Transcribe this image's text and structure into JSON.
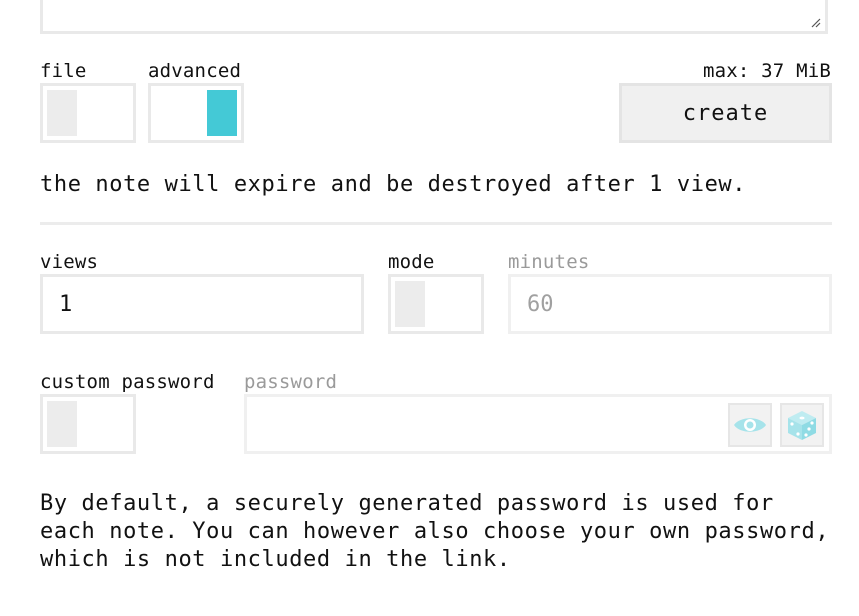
{
  "file_toggle": {
    "label": "file",
    "state": "off"
  },
  "advanced_toggle": {
    "label": "advanced",
    "state": "on"
  },
  "max_size_label": "max: 37 MiB",
  "create_button_label": "create",
  "expire_message": "the note will expire and be destroyed after 1 view.",
  "views": {
    "label": "views",
    "value": "1"
  },
  "mode_toggle": {
    "label": "mode",
    "state": "off"
  },
  "minutes": {
    "label": "minutes",
    "placeholder": "60"
  },
  "custom_password_toggle": {
    "label": "custom password",
    "state": "off"
  },
  "password": {
    "label": "password",
    "value": ""
  },
  "icons": {
    "show_password": "eye-icon",
    "generate_password": "dice-icon"
  },
  "help_text": "By default, a securely generated password is used for each note. You can however also choose your own password, which is not included in the link.",
  "colors": {
    "accent": "#44c9d6",
    "icon_accent": "#a6e3ea",
    "border": "#e9e9e9",
    "knob_off": "#ececec",
    "muted_text": "#9a9a9a"
  }
}
